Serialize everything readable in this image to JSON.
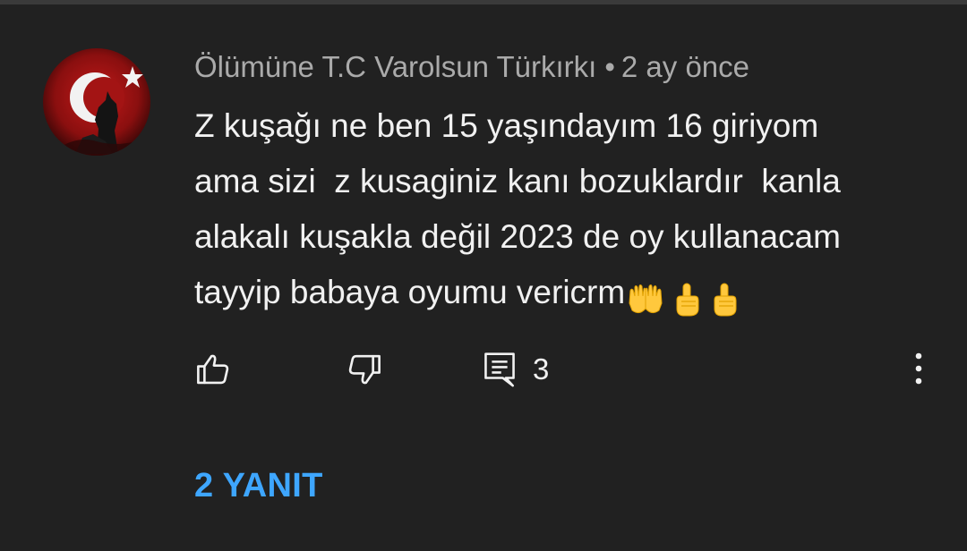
{
  "comment": {
    "author": "Ölümüne T.C Varolsun Türkırkı",
    "separator": "•",
    "time": "2 ay önce",
    "text_lines": [
      "Z kuşağı ne ben 15 yaşındayım 16 giriyom",
      "ama sizi  z kusaginiz kanı bozuklardır  kanla",
      "alakalı kuşakla değil 2023 de oy kullanacam",
      "tayyip babaya oyumu vericrm"
    ],
    "emojis": [
      "palms-up-together-emoji",
      "index-pointing-up-emoji",
      "index-pointing-up-emoji"
    ]
  },
  "actions": {
    "like_icon": "thumbs-up-icon",
    "dislike_icon": "thumbs-down-icon",
    "reply_icon": "comment-icon",
    "reply_count": "3",
    "more_icon": "more-vertical-icon"
  },
  "replies": {
    "label": "2 YANIT",
    "color": "#3ea6ff"
  },
  "colors": {
    "background": "#212121",
    "text_primary": "#f1f1f1",
    "text_secondary": "#aaaaaa",
    "link": "#3ea6ff"
  }
}
